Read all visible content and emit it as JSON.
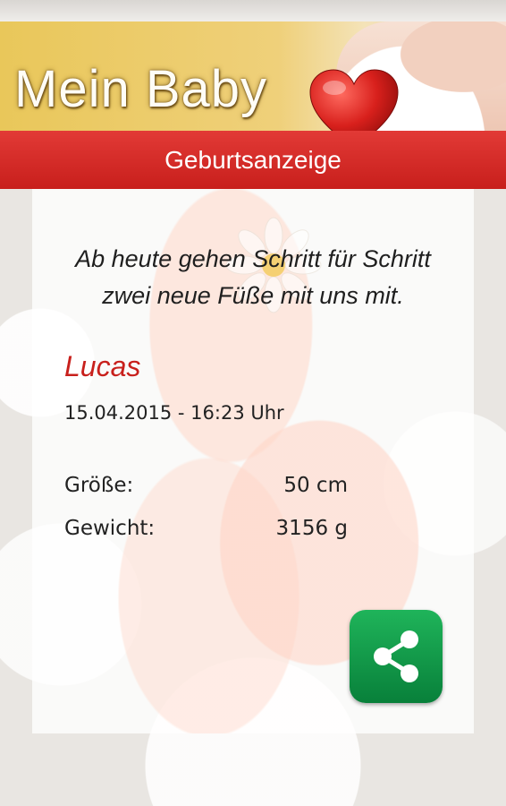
{
  "header": {
    "app_title": "Mein Baby",
    "heart_icon": "heart-icon",
    "accent_color": "#e9c75a"
  },
  "section_bar": {
    "title": "Geburtsanzeige",
    "color": "#d22a27"
  },
  "announcement": {
    "quote_line1": "Ab heute gehen Schritt für Schritt",
    "quote_line2": "zwei neue Füße mit uns mit.",
    "baby_name": "Lucas",
    "birth_datetime": "15.04.2015 - 16:23 Uhr",
    "size_label": "Größe:",
    "size_value": "50 cm",
    "weight_label": "Gewicht:",
    "weight_value": "3156 g"
  },
  "share": {
    "icon": "share-icon",
    "color": "#14a04c"
  }
}
